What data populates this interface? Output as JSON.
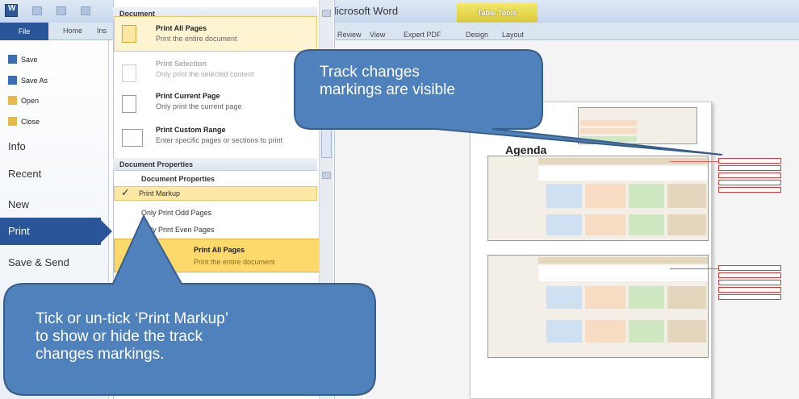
{
  "titlebar": {
    "app_title": "- Microsoft Word",
    "table_tools": "Table Tools",
    "w": "W"
  },
  "ribbon": {
    "file": "File",
    "home": "Home",
    "ins": "Ins",
    "tabs_right": [
      "Review",
      "View",
      "Expert PDF",
      "Design",
      "Layout"
    ]
  },
  "nav": {
    "save": "Save",
    "save_as": "Save As",
    "open": "Open",
    "close": "Close",
    "info": "Info",
    "recent": "Recent",
    "new": "New",
    "print": "Print",
    "save_send": "Save & Send"
  },
  "panel": {
    "document_header": "Document",
    "options": [
      {
        "title": "Print All Pages",
        "desc": "Print the entire document"
      },
      {
        "title": "Print Selection",
        "desc": "Only print the selected content"
      },
      {
        "title": "Print Current Page",
        "desc": "Only print the current page"
      },
      {
        "title": "Print Custom Range",
        "desc": "Enter specific pages or sections to print"
      }
    ],
    "doc_props_header": "Document Properties",
    "doc_props_item": "Document Properties",
    "print_markup": "Print Markup",
    "odd_pages": "Only Print Odd Pages",
    "even_pages": "Only Print Even Pages",
    "bottom_title": "Print All Pages",
    "bottom_desc": "Print the entire document"
  },
  "document": {
    "agenda": "Agenda"
  },
  "callouts": {
    "top": "Track changes markings are visible",
    "top_line1": "Track changes",
    "top_line2": "markings are visible",
    "bottom_line1": "Tick or un-tick ‘Print Markup’",
    "bottom_line2": "to show or hide the track",
    "bottom_line3": "changes markings."
  },
  "colors": {
    "callout_fill": "#4f81bd",
    "callout_stroke": "#385d8a",
    "selected_nav": "#2a5699",
    "highlight": "#fdd86b",
    "markup_red": "#e03a3a"
  }
}
